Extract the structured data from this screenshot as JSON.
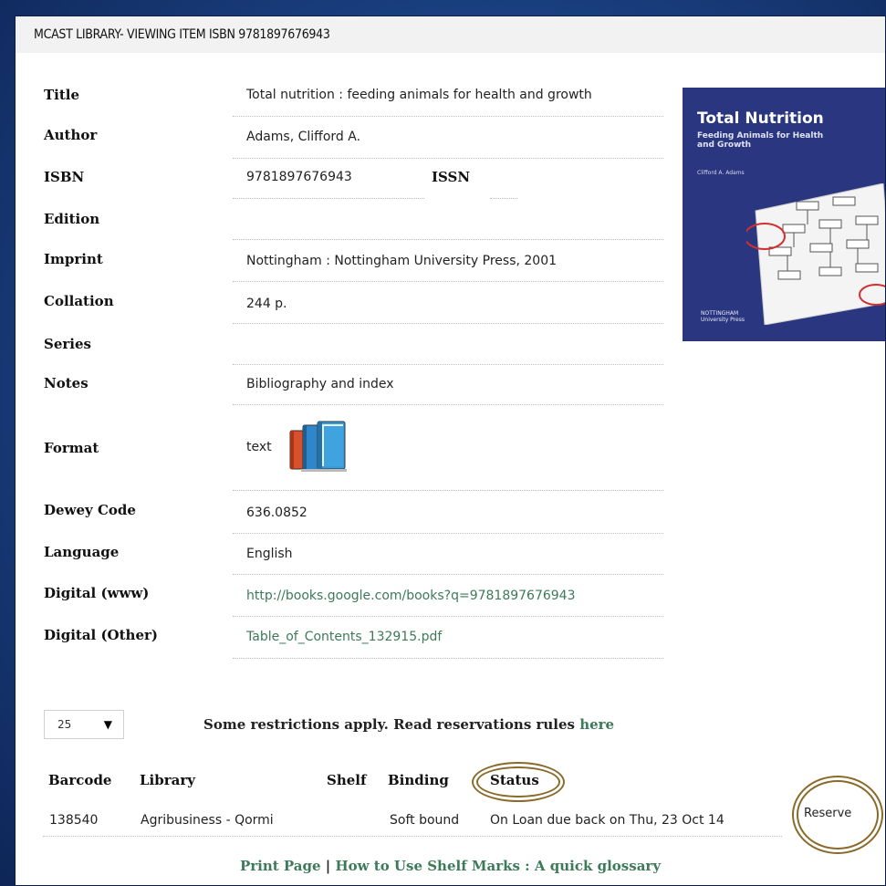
{
  "window": {
    "title": "MCAST LIBRARY- VIEWING ITEM ISBN 9781897676943"
  },
  "details": {
    "title": {
      "label": "Title",
      "value": "Total nutrition : feeding animals for health and growth"
    },
    "author": {
      "label": "Author",
      "value": "Adams, Clifford A."
    },
    "isbn": {
      "label": "ISBN",
      "value": "9781897676943"
    },
    "issn": {
      "label": "ISSN",
      "value": ""
    },
    "edition": {
      "label": "Edition",
      "value": ""
    },
    "imprint": {
      "label": "Imprint",
      "value": "Nottingham : Nottingham University Press, 2001"
    },
    "collation": {
      "label": "Collation",
      "value": "244 p."
    },
    "series": {
      "label": "Series",
      "value": ""
    },
    "notes": {
      "label": "Notes",
      "value": "Bibliography and index"
    },
    "format": {
      "label": "Format",
      "value": "text",
      "icon": "books-icon"
    },
    "dewey": {
      "label": "Dewey Code",
      "value": "636.0852"
    },
    "language": {
      "label": "Language",
      "value": "English"
    },
    "digital_www": {
      "label": "Digital (www)",
      "value": "http://books.google.com/books?q=9781897676943"
    },
    "digital_other": {
      "label": "Digital (Other)",
      "value": "Table_of_Contents_132915.pdf"
    }
  },
  "cover": {
    "title": "Total Nutrition",
    "subtitle_line1": "Feeding Animals for Health",
    "subtitle_line2": "and Growth",
    "author": "Clifford A. Adams",
    "publisher_line1": "NOTTINGHAM",
    "publisher_line2": "University Press"
  },
  "pager": {
    "selected": "25"
  },
  "restrictions": {
    "text": "Some restrictions apply. Read reservations rules ",
    "link": "here"
  },
  "holdings": {
    "headers": {
      "barcode": "Barcode",
      "library": "Library",
      "shelf": "Shelf",
      "binding": "Binding",
      "status": "Status"
    },
    "rows": [
      {
        "barcode": "138540",
        "library": "Agribusiness - Qormi",
        "shelf": "",
        "binding": "Soft bound",
        "status": "On Loan due back on Thu, 23 Oct 14",
        "action": "Reserve"
      }
    ]
  },
  "footer": {
    "print": "Print Page",
    "sep": "|",
    "glossary": "How to Use Shelf Marks : A quick glossary"
  },
  "colors": {
    "link": "#3c7a5a",
    "annotation_circle": "#8a6a2a",
    "background": "#1a3f80"
  }
}
